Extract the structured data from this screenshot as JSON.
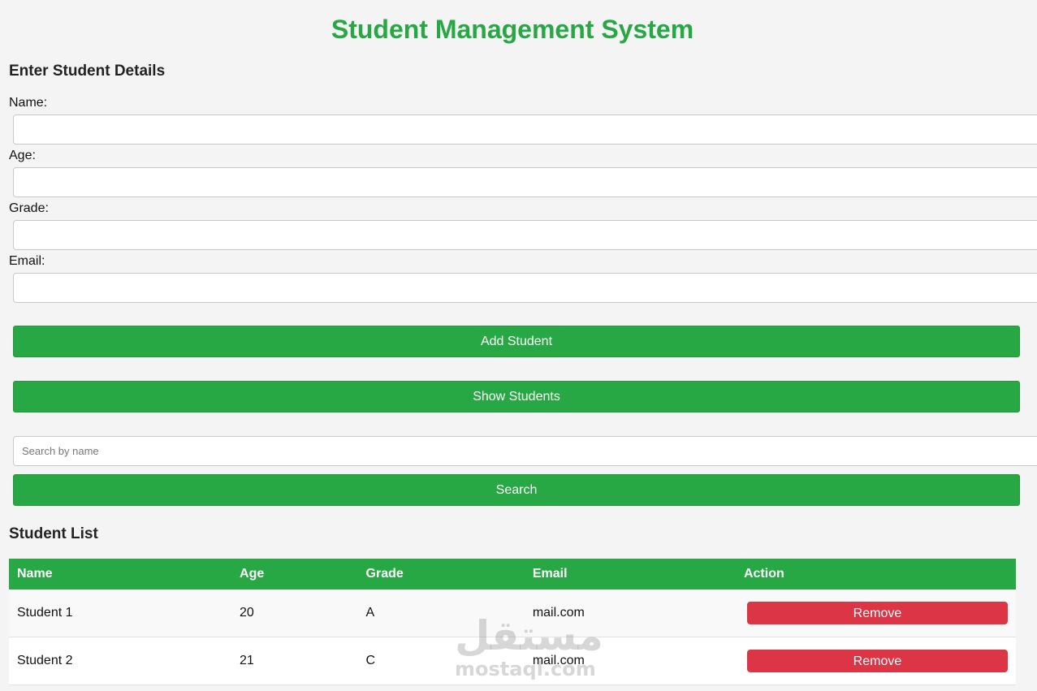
{
  "header": {
    "title": "Student Management System"
  },
  "form": {
    "heading": "Enter Student Details",
    "fields": [
      {
        "label": "Name:",
        "value": ""
      },
      {
        "label": "Age:",
        "value": ""
      },
      {
        "label": "Grade:",
        "value": ""
      },
      {
        "label": "Email:",
        "value": ""
      }
    ],
    "add_button": "Add Student",
    "show_button": "Show Students"
  },
  "search": {
    "placeholder": "Search by name",
    "value": "",
    "button": "Search"
  },
  "student_list": {
    "heading": "Student List",
    "columns": [
      "Name",
      "Age",
      "Grade",
      "Email",
      "Action"
    ],
    "rows": [
      {
        "name": "Student 1",
        "age": "20",
        "grade": "A",
        "email": "mail.com",
        "action": "Remove"
      },
      {
        "name": "Student 2",
        "age": "21",
        "grade": "C",
        "email": "mail.com",
        "action": "Remove"
      }
    ]
  },
  "watermark": {
    "arabic": "مستقل",
    "latin": "mostaql.com"
  },
  "colors": {
    "primary_green": "#28a745",
    "danger_red": "#dc3545",
    "background": "#f4f4f4"
  }
}
